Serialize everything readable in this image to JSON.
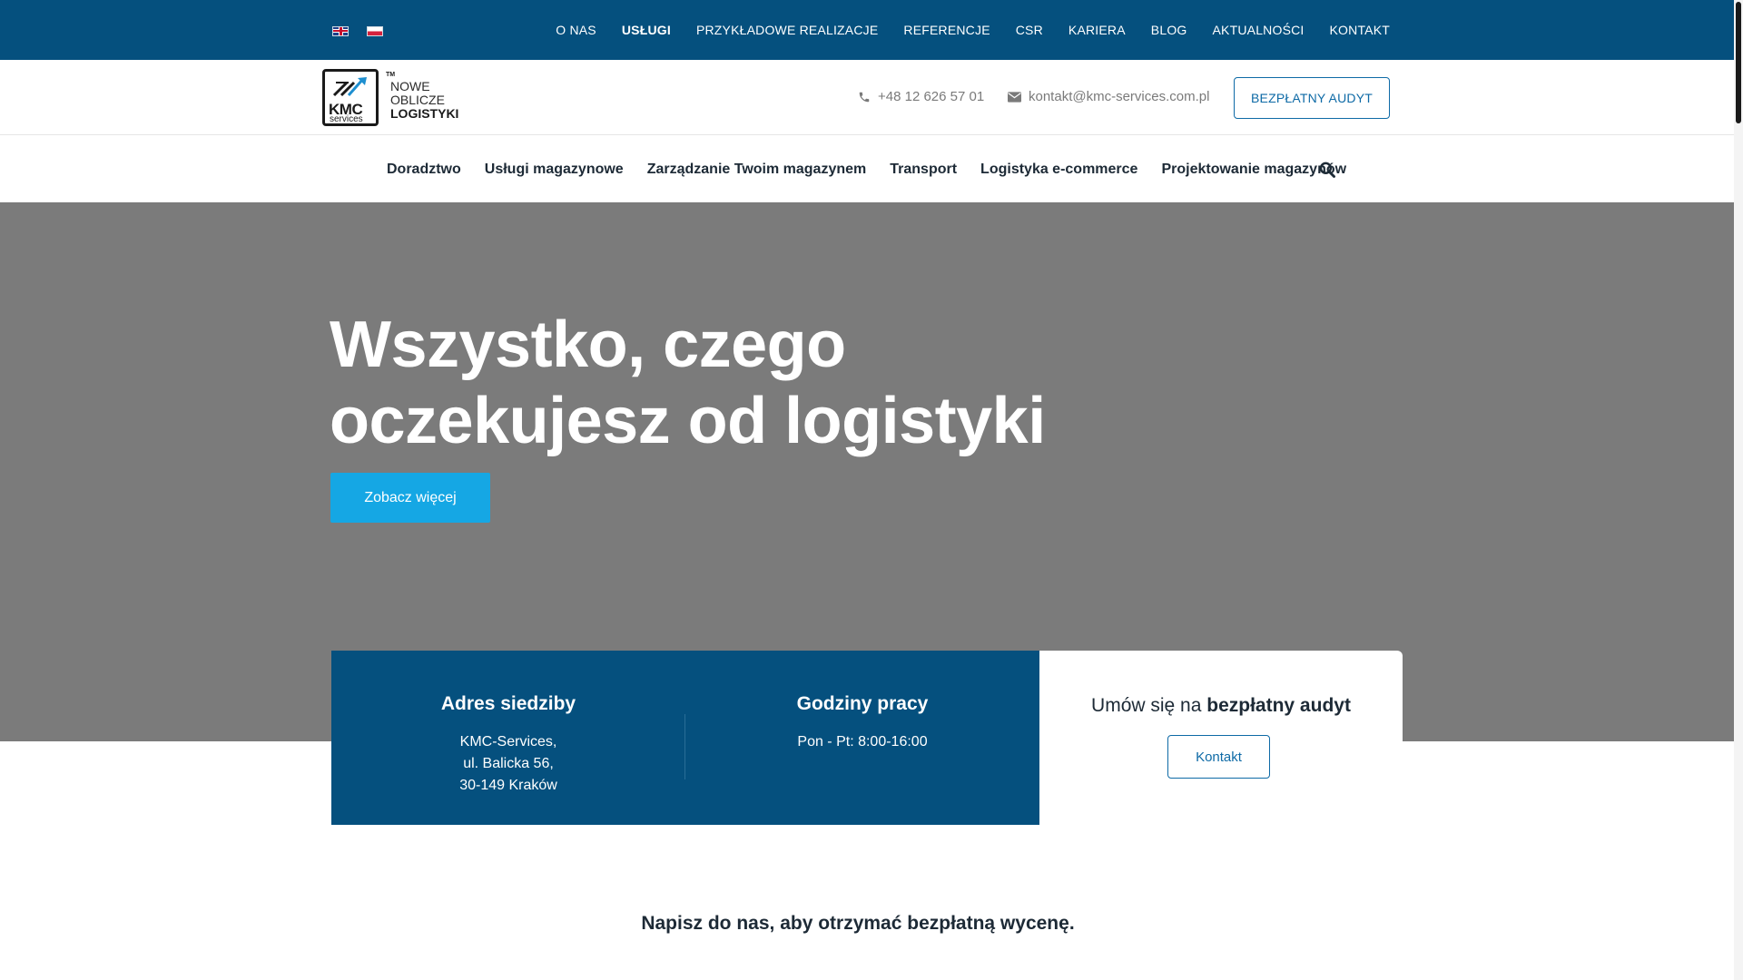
{
  "topbar": {
    "languages": [
      {
        "code": "en",
        "icon": "uk-flag-icon"
      },
      {
        "code": "pl",
        "icon": "poland-flag-icon"
      }
    ],
    "nav": [
      {
        "label": "O NAS",
        "active": false
      },
      {
        "label": "USŁUGI",
        "active": true
      },
      {
        "label": "PRZYKŁADOWE REALIZACJE",
        "active": false
      },
      {
        "label": "REFERENCJE",
        "active": false
      },
      {
        "label": "CSR",
        "active": false
      },
      {
        "label": "KARIERA",
        "active": false
      },
      {
        "label": "BLOG",
        "active": false
      },
      {
        "label": "AKTUALNOŚCI",
        "active": false
      },
      {
        "label": "KONTAKT",
        "active": false
      }
    ]
  },
  "header": {
    "logo": {
      "brand": "KMC",
      "sub": "services",
      "tm": "TM",
      "tagline_1": "NOWE",
      "tagline_2": "OBLICZE",
      "tagline_3": "LOGISTYKI"
    },
    "phone": "+48 12 626 57 01",
    "email": "kontakt@kmc-services.com.pl",
    "audit_button": "BEZPŁATNY AUDYT"
  },
  "mainnav": {
    "items": [
      "Doradztwo",
      "Usługi magazynowe",
      "Zarządzanie Twoim magazynem",
      "Transport",
      "Logistyka e-commerce",
      "Projektowanie magazynów"
    ]
  },
  "hero": {
    "title_line1": "Wszystko, czego",
    "title_line2": "oczekujesz od logistyki",
    "button": "Zobacz więcej"
  },
  "info": {
    "address_title": "Adres siedziby",
    "address_lines": [
      "KMC-Services,",
      "ul. Balicka 56,",
      "30-149 Kraków"
    ],
    "hours_title": "Godziny pracy",
    "hours": "Pon - Pt: 8:00-16:00",
    "audit_title_pre": "Umów się na ",
    "audit_title_bold": "bezpłatny audyt",
    "contact_button": "Kontakt"
  },
  "bottom": {
    "text": "Napisz do nas, aby otrzymać bezpłatną wycenę."
  },
  "colors": {
    "primary_dark": "#05507e",
    "accent": "#15a7e4",
    "hero_bg": "#7b7b7b"
  }
}
